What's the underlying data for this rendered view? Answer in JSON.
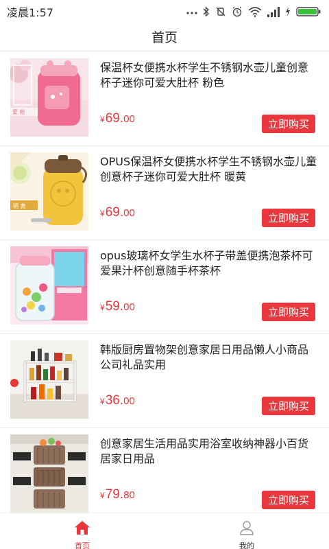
{
  "status_bar": {
    "time": "凌晨1:57",
    "icons": [
      "more-dots-icon",
      "bluetooth-icon",
      "mute-icon",
      "alarm-icon",
      "wifi-icon",
      "signal-icon",
      "charging-icon",
      "battery-icon"
    ]
  },
  "header": {
    "title": "首页"
  },
  "colors": {
    "accent": "#e8383d",
    "text": "#222222",
    "divider": "#e8e8e8",
    "battery_fill": "#3cc13c"
  },
  "products": [
    {
      "title": "保温杯女便携水杯学生不锈钢水壶儿童创意杯子迷你可爱大肚杯 粉色",
      "currency": "¥",
      "price_int": "69.",
      "price_cents": "00",
      "buy_label": "立即购买",
      "thumb_badge": "爱 粉"
    },
    {
      "title": "OPUS保温杯女便携水杯学生不锈钢水壶儿童创意杯子迷你可爱大肚杯 暖黄",
      "currency": "¥",
      "price_int": "69.",
      "price_cents": "00",
      "buy_label": "立即购买",
      "thumb_badge": "明 黄"
    },
    {
      "title": "opus玻璃杯女学生水杯子带盖便携泡茶杯可爱果汁杯创意随手杯茶杯",
      "currency": "¥",
      "price_int": "59.",
      "price_cents": "00",
      "buy_label": "立即购买",
      "thumb_badge": ""
    },
    {
      "title": "韩版厨房置物架创意家居日用品懒人小商品公司礼品实用",
      "currency": "¥",
      "price_int": "36.",
      "price_cents": "00",
      "buy_label": "立即购买",
      "thumb_badge": ""
    },
    {
      "title": "创意家居生活用品实用浴室收纳神器小百货居家日用品",
      "currency": "¥",
      "price_int": "79.",
      "price_cents": "80",
      "buy_label": "立即购买",
      "thumb_badge": ""
    }
  ],
  "tab_bar": {
    "home_label": "首页",
    "mine_label": "我的",
    "active": "home"
  }
}
